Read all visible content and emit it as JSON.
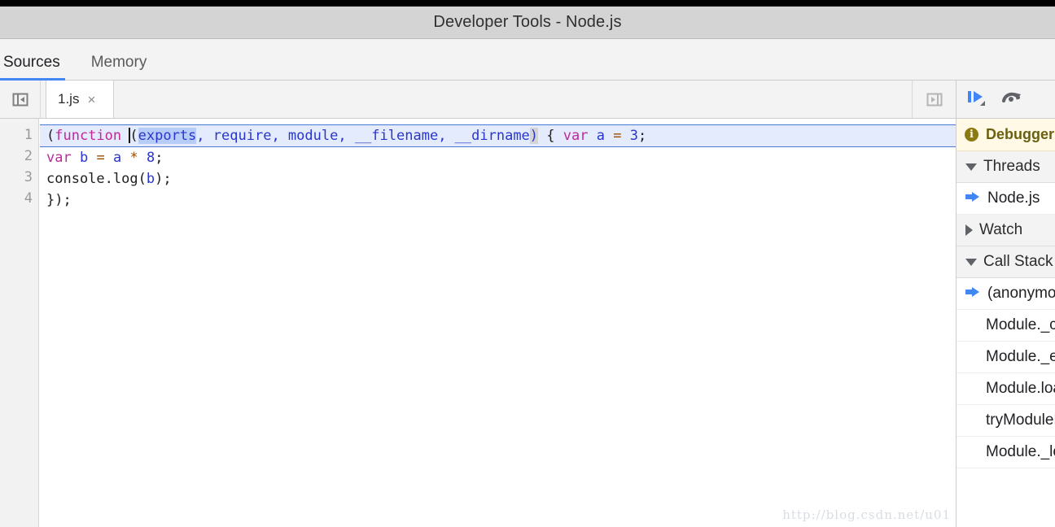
{
  "window": {
    "title": "Developer Tools - Node.js"
  },
  "panel_tabs": [
    {
      "label": "Sources",
      "active": true
    },
    {
      "label": "Memory",
      "active": false
    }
  ],
  "editor": {
    "left_toolbar_icon": "show-navigator-icon",
    "right_toolbar_icon": "show-debugger-icon",
    "tab": {
      "filename": "1.js",
      "close_label": "×"
    },
    "gutter": [
      "1",
      "2",
      "3",
      "4"
    ],
    "lines": [
      {
        "n": "1",
        "executing": true,
        "tokens": [
          {
            "t": "(",
            "c": "tok-plain"
          },
          {
            "t": "function",
            "c": "tok-kw"
          },
          {
            "t": " ",
            "c": "tok-plain"
          },
          {
            "t": "(",
            "c": "tok-plain"
          },
          {
            "t": "exports",
            "c": "tok-var sel"
          },
          {
            "t": ", ",
            "c": "tok-var"
          },
          {
            "t": "require",
            "c": "tok-var"
          },
          {
            "t": ", ",
            "c": "tok-var"
          },
          {
            "t": "module",
            "c": "tok-var"
          },
          {
            "t": ", ",
            "c": "tok-var"
          },
          {
            "t": "__filename",
            "c": "tok-var"
          },
          {
            "t": ", ",
            "c": "tok-var"
          },
          {
            "t": "__dirname",
            "c": "tok-var"
          },
          {
            "t": ")",
            "c": "tok-var bracket-hl"
          },
          {
            "t": " { ",
            "c": "tok-plain"
          },
          {
            "t": "var",
            "c": "tok-kw"
          },
          {
            "t": " ",
            "c": "tok-plain"
          },
          {
            "t": "a",
            "c": "tok-var"
          },
          {
            "t": " ",
            "c": "tok-plain"
          },
          {
            "t": "=",
            "c": "tok-op"
          },
          {
            "t": " ",
            "c": "tok-plain"
          },
          {
            "t": "3",
            "c": "tok-num"
          },
          {
            "t": ";",
            "c": "tok-plain"
          }
        ]
      },
      {
        "n": "2",
        "executing": false,
        "tokens": [
          {
            "t": "var",
            "c": "tok-kw"
          },
          {
            "t": " ",
            "c": "tok-plain"
          },
          {
            "t": "b",
            "c": "tok-var"
          },
          {
            "t": " ",
            "c": "tok-plain"
          },
          {
            "t": "=",
            "c": "tok-op"
          },
          {
            "t": " ",
            "c": "tok-plain"
          },
          {
            "t": "a",
            "c": "tok-var"
          },
          {
            "t": " ",
            "c": "tok-plain"
          },
          {
            "t": "*",
            "c": "tok-op"
          },
          {
            "t": " ",
            "c": "tok-plain"
          },
          {
            "t": "8",
            "c": "tok-num"
          },
          {
            "t": ";",
            "c": "tok-plain"
          }
        ]
      },
      {
        "n": "3",
        "executing": false,
        "tokens": [
          {
            "t": "console.log(",
            "c": "tok-plain"
          },
          {
            "t": "b",
            "c": "tok-var"
          },
          {
            "t": ");",
            "c": "tok-plain"
          }
        ]
      },
      {
        "n": "4",
        "executing": false,
        "tokens": [
          {
            "t": "});",
            "c": "tok-plain"
          }
        ]
      }
    ],
    "watermark": "http://blog.csdn.net/u01"
  },
  "debugger": {
    "toolbar": [
      {
        "name": "resume-script-execution-icon"
      },
      {
        "name": "step-over-next-function-call-icon"
      }
    ],
    "banner": {
      "icon": "info-icon",
      "badge": "i",
      "text": "Debugger paused"
    },
    "sections": [
      {
        "kind": "section",
        "name": "threads",
        "label": "Threads",
        "expanded": true,
        "caret": "down"
      },
      {
        "kind": "row",
        "name": "thread-node-js",
        "label": "Node.js",
        "marker": "current-frame-arrow"
      },
      {
        "kind": "section",
        "name": "watch",
        "label": "Watch",
        "expanded": false,
        "caret": "right"
      },
      {
        "kind": "section",
        "name": "call-stack",
        "label": "Call Stack",
        "expanded": true,
        "caret": "down"
      },
      {
        "kind": "row",
        "name": "call-frame-anonymous",
        "label": "(anonymous)",
        "marker": "current-frame-arrow"
      },
      {
        "kind": "row",
        "name": "call-frame-module-compile",
        "label": "Module._compile",
        "marker": ""
      },
      {
        "kind": "row",
        "name": "call-frame-module-extensions-js",
        "label": "Module._extensions..js",
        "marker": ""
      },
      {
        "kind": "row",
        "name": "call-frame-module-load",
        "label": "Module.load",
        "marker": ""
      },
      {
        "kind": "row",
        "name": "call-frame-try-module-load",
        "label": "tryModuleLoad",
        "marker": ""
      },
      {
        "kind": "row",
        "name": "call-frame-module-load-2",
        "label": "Module._load",
        "marker": ""
      }
    ]
  },
  "colors": {
    "accent": "#4285f4",
    "keyword": "#c0299a",
    "variable": "#2a36c9",
    "operator": "#9a4d00",
    "exec_line_bg": "#e3ebfd",
    "banner_bg": "#fff9e5",
    "banner_fg": "#6b5f10"
  }
}
